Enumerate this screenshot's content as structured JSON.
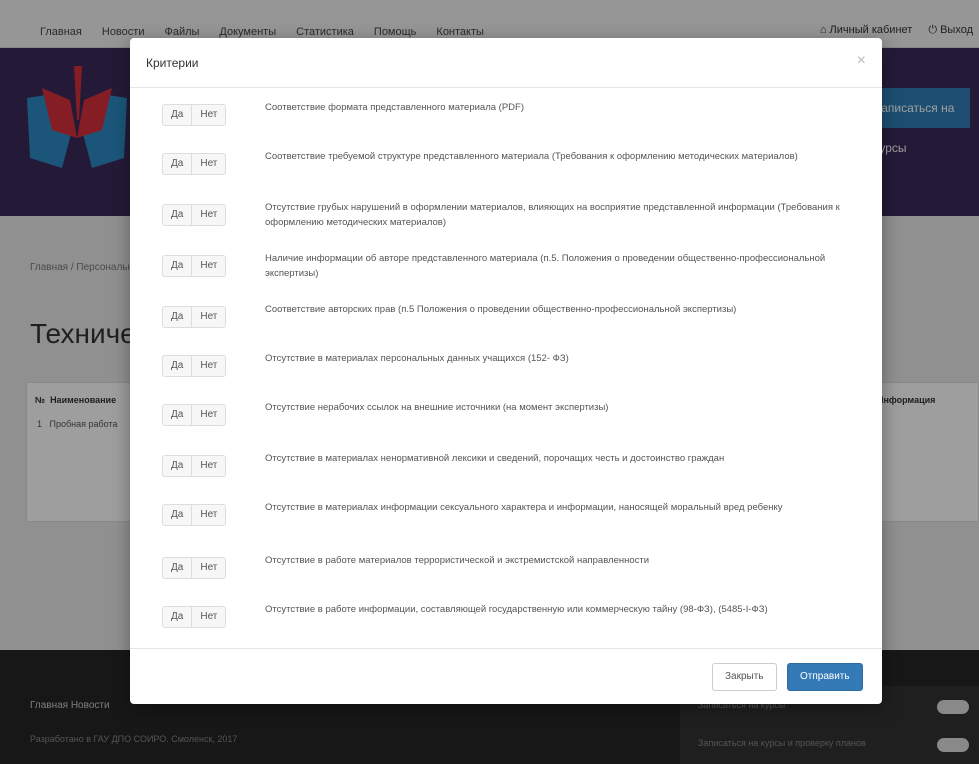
{
  "nav": {
    "links": [
      "Главная",
      "Новости",
      "Файлы",
      "Документы",
      "Статистика",
      "Помощь",
      "Контакты"
    ],
    "account": "Личный кабинет",
    "logout": "Выход"
  },
  "hero": {
    "button": "Записаться на курсы"
  },
  "breadcrumb": "Главная / Персональный раздел",
  "page_title": "Техническая экспертиза",
  "bg_table": {
    "col_num": "№",
    "col_name": "Наименование",
    "row_num": "1",
    "row_name": "Пробная работа",
    "right_header": "Информация"
  },
  "footer": {
    "links": "Главная   Новости",
    "copyright": "Разработано в ГАУ ДПО СОИРО. Смоленск, 2017",
    "side_row1": "Записаться на курсы",
    "side_row2": "Записаться на курсы и проверку планов"
  },
  "modal": {
    "title": "Критерии",
    "close_icon": "×",
    "yes_label": "Да",
    "no_label": "Нет",
    "criteria": [
      "Соответствие формата представленного материала (PDF)",
      "Соответствие требуемой структуре представленного материала (Требования к оформлению методических материалов)",
      "Отсутствие грубых нарушений в оформлении материалов, влияющих на восприятие представленной информации (Требования к оформлению методических материалов)",
      "Наличие информации об авторе представленного материала (п.5. Положения о проведении общественно-профессиональной экспертизы)",
      "Соответствие авторских прав (п.5 Положения о проведении общественно-профессиональной экспертизы)",
      "Отсутствие в материалах персональных данных учащихся (152- ФЗ)",
      "Отсутствие нерабочих ссылок на внешние источники (на момент экспертизы)",
      "Отсутствие в материалах ненормативной лексики и сведений, порочащих честь и достоинство граждан",
      "Отсутствие в материалах информации сексуального характера и информации, наносящей моральный вред ребенку",
      "Отсутствие в работе материалов террористической и экстремистской направленности",
      "Отсутствие в работе информации, составляющей государственную или коммерческую тайну (98-ФЗ), (5485-I-ФЗ)"
    ],
    "close_button": "Закрыть",
    "send_button": "Отправить"
  }
}
